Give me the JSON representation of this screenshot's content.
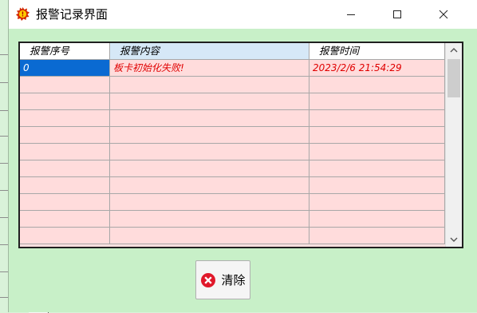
{
  "window": {
    "title": "报警记录界面"
  },
  "table": {
    "columns": [
      "报警序号",
      "报警内容",
      "报警时间"
    ],
    "rows": [
      {
        "id": "0",
        "content": "板卡初始化失败!",
        "time": "2023/2/6 21:54:29"
      }
    ]
  },
  "actions": {
    "clear_label": "清除"
  },
  "colors": {
    "window_bg": "#c8f0c8",
    "grid_row_bg": "#ffdcdc",
    "alarm_text": "#e00000",
    "selection": "#0a6ad2"
  }
}
